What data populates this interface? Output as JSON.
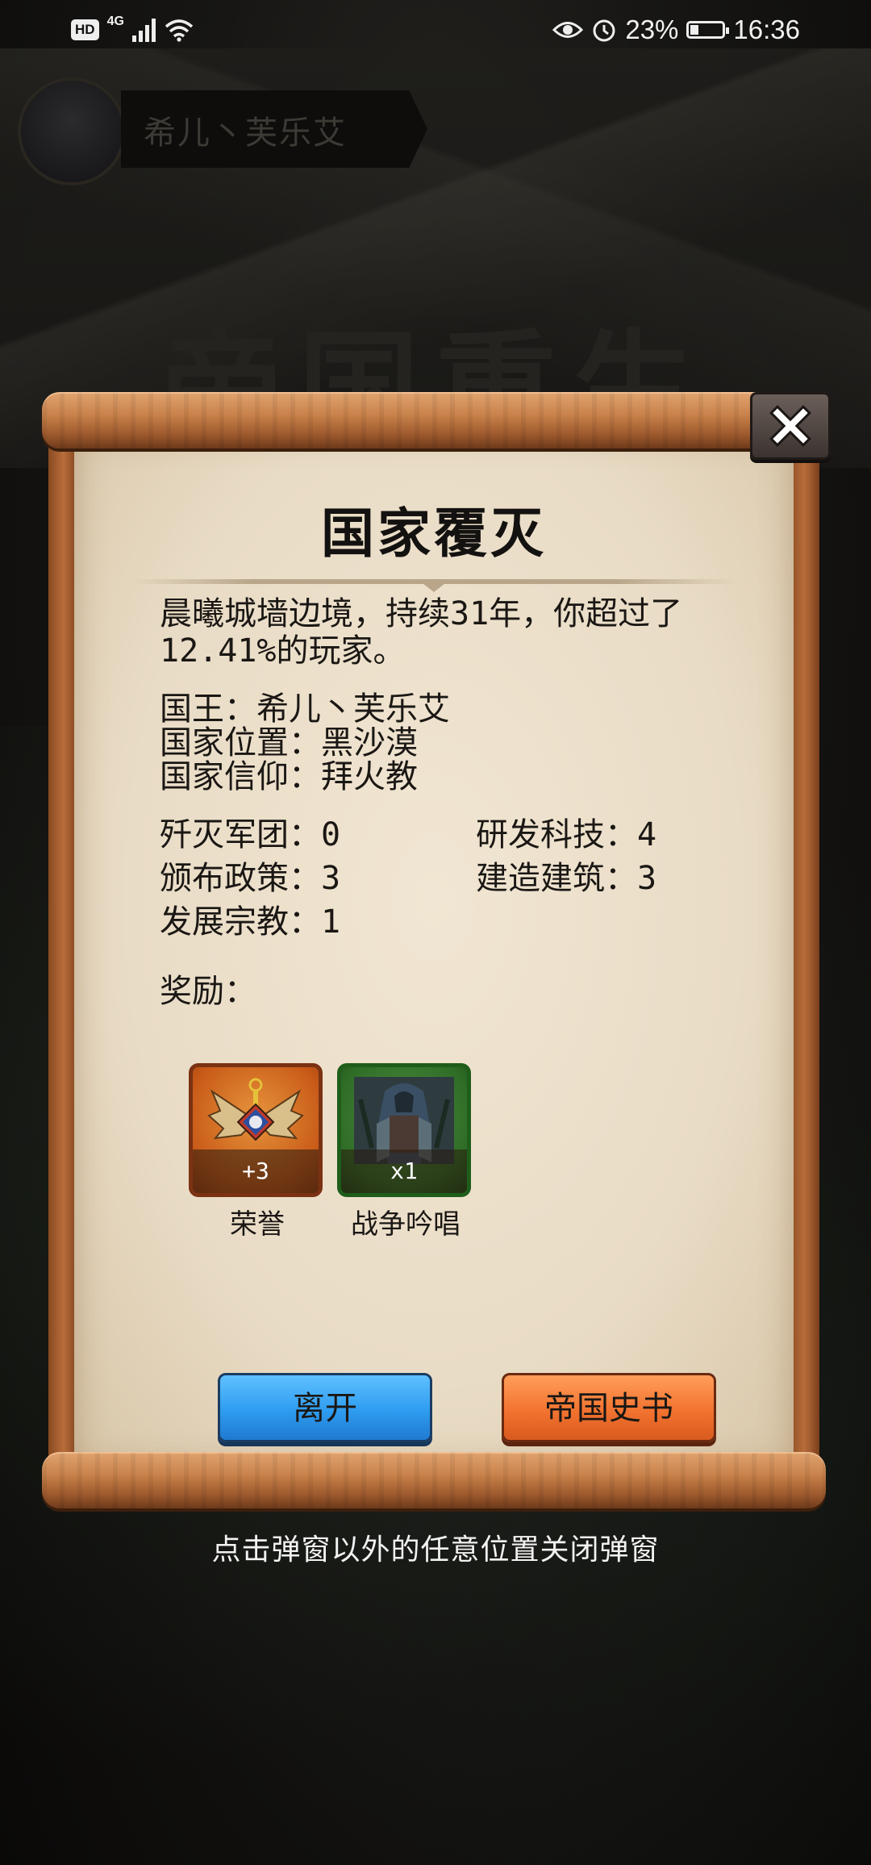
{
  "status_bar": {
    "hd": "HD",
    "network": "4G",
    "battery": "23%",
    "time": "16:36"
  },
  "background": {
    "player_name": "希儿丶芙乐艾",
    "banner_title": "帝国重生"
  },
  "dialog": {
    "title": "国家覆灭",
    "summary": "晨曦城墙边境，持续31年，你超过了12.41%的玩家。",
    "king": "国王：希儿丶芙乐艾",
    "location": "国家位置：黑沙漠",
    "faith": "国家信仰：拜火教",
    "stats": {
      "armies_destroyed": "歼灭军团：0",
      "tech_researched": "研发科技：4",
      "policies_issued": "颁布政策：3",
      "buildings_built": "建造建筑：3",
      "religions_developed": "发展宗教：1"
    },
    "rewards_label": "奖励：",
    "rewards": [
      {
        "name": "荣誉",
        "count": "+3",
        "icon": "honor-emblem-icon",
        "frame_color": "#d9661f"
      },
      {
        "name": "战争吟唱",
        "count": "x1",
        "icon": "war-chant-card-icon",
        "frame_color": "#3d7a31"
      }
    ],
    "leave_button": "离开",
    "history_button": "帝国史书"
  },
  "hint": "点击弹窗以外的任意位置关闭弹窗",
  "colors": {
    "paper": "#ece0cb",
    "scroll_wood": "#c9824b",
    "leave_button": "#2e9cf0",
    "history_button": "#f27330"
  }
}
